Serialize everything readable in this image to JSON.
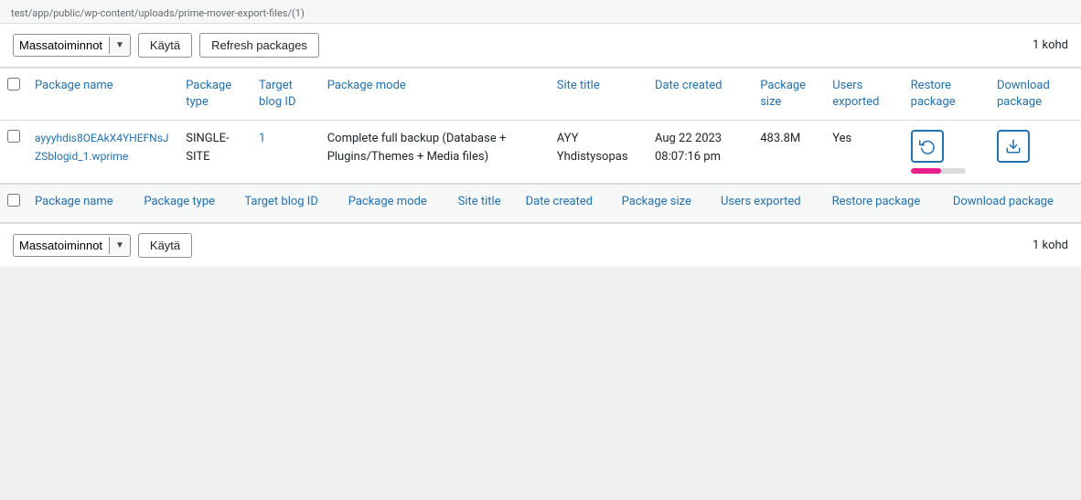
{
  "topbar": {
    "path": "test/app/public/wp-content/uploads/prime-mover-export-files/(1)"
  },
  "toolbar": {
    "bulk_label": "Massatoiminnot",
    "apply_label": "Käytä",
    "refresh_label": "Refresh packages",
    "count_text": "1 kohd"
  },
  "table_header": {
    "checkbox": "",
    "package_name": "Package name",
    "package_type": "Package type",
    "target_blog_id": "Target blog ID",
    "package_mode": "Package mode",
    "site_title": "Site title",
    "date_created": "Date created",
    "package_size": "Package size",
    "users_exported": "Users exported",
    "restore_package": "Restore package",
    "download_package": "Download package"
  },
  "rows": [
    {
      "id": "row-1",
      "package_name": "ayyyhdis8OEAkX4YHEFNsJZSblogid_1.wprime",
      "package_type": "SINGLE-SITE",
      "target_blog_id": "1",
      "package_mode": "Complete full backup (Database + Plugins/Themes + Media files)",
      "site_title": "AYY Yhdistysopas",
      "date_created": "Aug 22 2023 08:07:16 pm",
      "package_size": "483.8M",
      "users_exported": "Yes",
      "restore_progress": 55
    }
  ],
  "bottom_toolbar": {
    "bulk_label": "Massatoiminnot",
    "apply_label": "Käytä",
    "count_text": "1 kohd"
  }
}
